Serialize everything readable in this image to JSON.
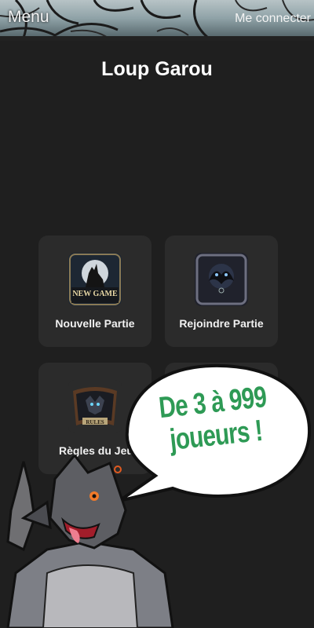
{
  "header": {
    "menu_label": "Menu",
    "login_label": "Me connecter"
  },
  "page": {
    "title": "Loup Garou"
  },
  "cards": {
    "new_game": {
      "label": "Nouvelle Partie",
      "thumb_text": "NEW GAME"
    },
    "join_game": {
      "label": "Rejoindre Partie"
    },
    "rules": {
      "label": "Règles du Jeu",
      "thumb_text": "RULES"
    }
  },
  "promo": {
    "line1": "De 3 à 999",
    "line2": "joueurs !",
    "color": "#2e9a55"
  },
  "colors": {
    "background": "#1f1f1f",
    "card": "#2b2b2b"
  }
}
